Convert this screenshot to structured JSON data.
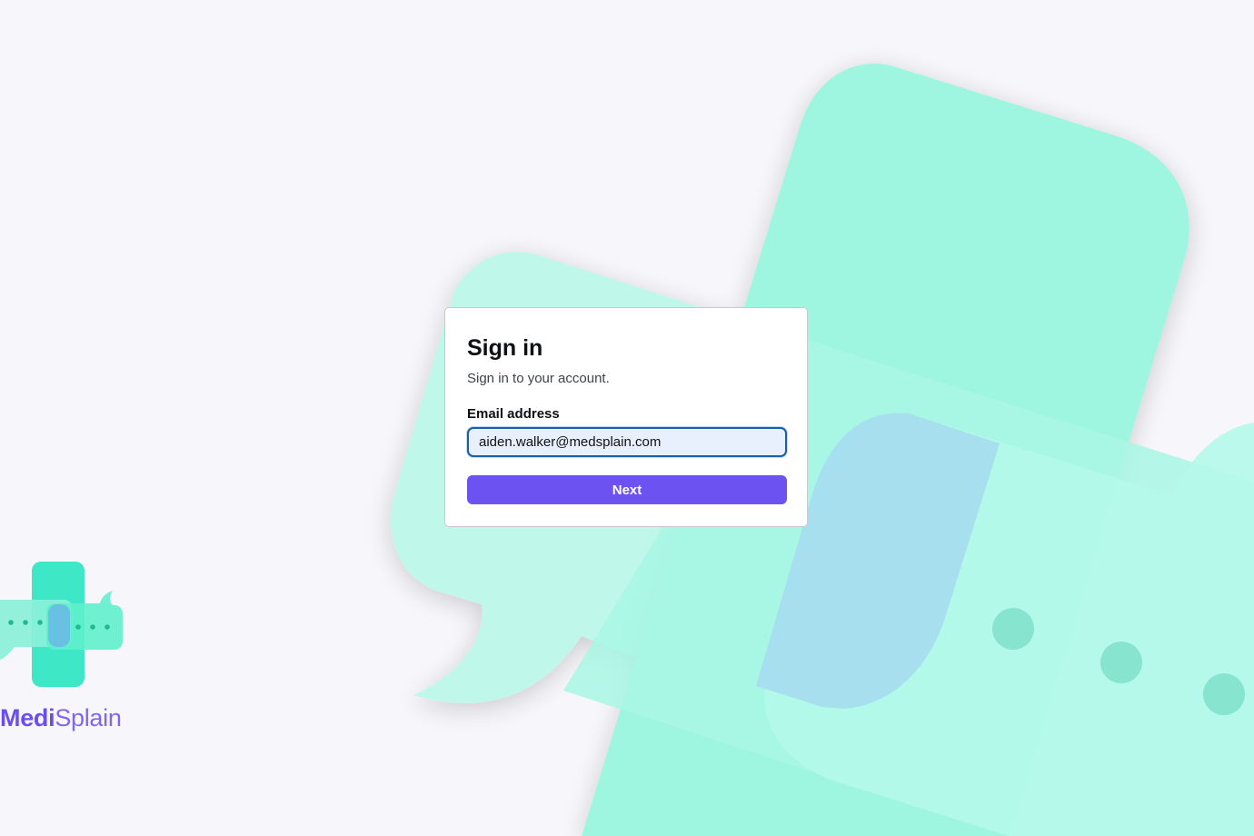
{
  "signin": {
    "title": "Sign in",
    "subtitle": "Sign in to your account.",
    "email_label": "Email address",
    "email_value": "aiden.walker@medsplain.com",
    "next_label": "Next"
  },
  "brand": {
    "name_part1": "Medi",
    "name_part2": "Splain",
    "primary_color": "#6c52f0",
    "accent_color": "#9ef5e0",
    "focus_color": "#1c5ea8"
  },
  "icons": {
    "background": "medical-cross-chat-bubbles-art",
    "logo": "medsplain-cross-chat-logo"
  }
}
